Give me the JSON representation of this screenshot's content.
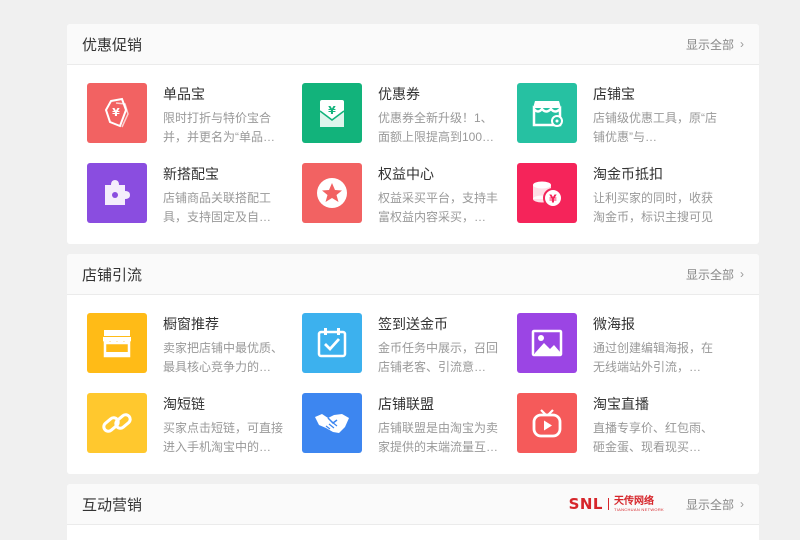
{
  "sections": [
    {
      "title": "优惠促销",
      "show_all": "显示全部",
      "tiles": [
        {
          "title": "单品宝",
          "desc": "限时打折与特价宝合并，并更名为“单品…",
          "color": "#f26262",
          "icon": "tag-icon"
        },
        {
          "title": "优惠券",
          "desc": "优惠券全新升级！1、面额上限提高到100…",
          "color": "#12b37b",
          "icon": "envelope-icon"
        },
        {
          "title": "店铺宝",
          "desc": "店铺级优惠工具，原“店铺优惠”与…",
          "color": "#26c1a2",
          "icon": "shop-icon"
        },
        {
          "title": "新搭配宝",
          "desc": "店铺商品关联搭配工具，支持固定及自…",
          "color": "#8a4de0",
          "icon": "puzzle-icon"
        },
        {
          "title": "权益中心",
          "desc": "权益采买平台，支持丰富权益内容采买，…",
          "color": "#f26262",
          "icon": "star-icon"
        },
        {
          "title": "淘金币抵扣",
          "desc": "让利买家的同时，收获淘金币，标识主搜可见",
          "color": "#f5245a",
          "icon": "coins-icon"
        }
      ]
    },
    {
      "title": "店铺引流",
      "show_all": "显示全部",
      "tiles": [
        {
          "title": "橱窗推荐",
          "desc": "卖家把店铺中最优质、最具核心竞争力的…",
          "color": "#ffbb17",
          "icon": "storefront-icon"
        },
        {
          "title": "签到送金币",
          "desc": "金币任务中展示，召回店铺老客、引流意…",
          "color": "#3cb1ee",
          "icon": "calendar-check-icon"
        },
        {
          "title": "微海报",
          "desc": "通过创建编辑海报，在无线端站外引流，…",
          "color": "#9b45e4",
          "icon": "image-icon"
        },
        {
          "title": "淘短链",
          "desc": "买家点击短链，可直接进入手机淘宝中的…",
          "color": "#ffc82e",
          "icon": "link-icon"
        },
        {
          "title": "店铺联盟",
          "desc": "店铺联盟是由淘宝为卖家提供的末端流量互…",
          "color": "#3d86f0",
          "icon": "handshake-icon"
        },
        {
          "title": "淘宝直播",
          "desc": "直播专享价、红包雨、砸金蛋、现看现买…",
          "color": "#f55a5a",
          "icon": "live-tv-icon"
        }
      ]
    },
    {
      "title": "互动营销",
      "show_all": "显示全部",
      "logo": {
        "brand": "SNL",
        "name": "天传网络",
        "sub": "TIANCHUAN NETWORK"
      }
    }
  ]
}
